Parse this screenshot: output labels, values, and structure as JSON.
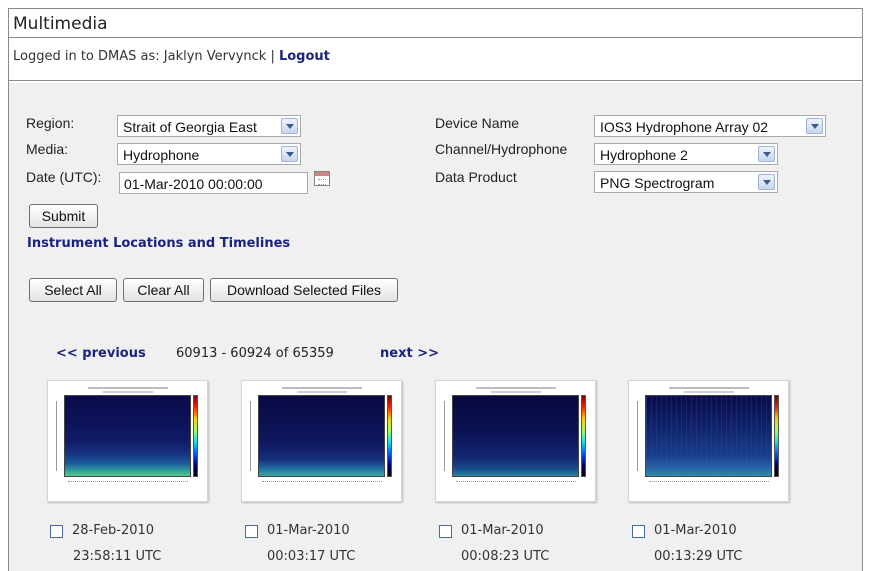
{
  "title": "Multimedia",
  "login": {
    "text": "Logged in to DMAS as: Jaklyn Vervynck | ",
    "logout": "Logout"
  },
  "form": {
    "region_label": "Region:",
    "region_value": "Strait of Georgia East",
    "media_label": "Media:",
    "media_value": "Hydrophone",
    "date_label": "Date (UTC):",
    "date_value": "01-Mar-2010 00:00:00",
    "device_label": "Device Name",
    "device_value": "IOS3 Hydrophone Array 02",
    "channel_label": "Channel/Hydrophone",
    "channel_value": "Hydrophone 2",
    "product_label": "Data Product",
    "product_value": "PNG Spectrogram",
    "submit_label": "Submit"
  },
  "instrument_link": "Instrument Locations and Timelines",
  "actions": {
    "select_all": "Select All",
    "clear_all": "Clear All",
    "download": "Download Selected Files"
  },
  "pager": {
    "previous": "<< previous",
    "range": "60913 - 60924 of 65359",
    "next": "next >>"
  },
  "items": [
    {
      "date": "28-Feb-2010",
      "time": "23:58:11 UTC"
    },
    {
      "date": "01-Mar-2010",
      "time": "00:03:17 UTC"
    },
    {
      "date": "01-Mar-2010",
      "time": "00:08:23 UTC"
    },
    {
      "date": "01-Mar-2010",
      "time": "00:13:29 UTC"
    }
  ],
  "icons": {
    "dropdown": "chevron-down-icon",
    "calendar": "calendar-icon",
    "checkbox": "checkbox-icon"
  }
}
